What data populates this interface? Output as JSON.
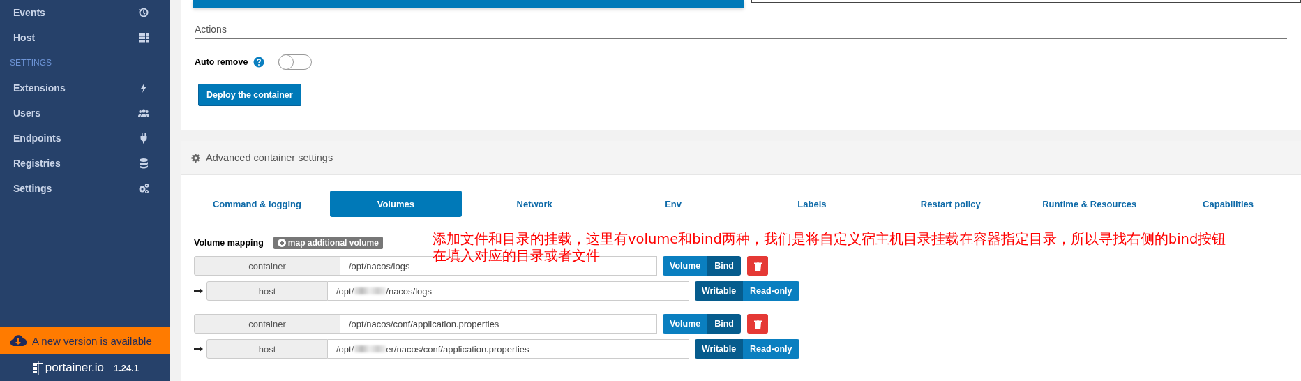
{
  "sidebar": {
    "items": [
      {
        "kind": "item",
        "label": "Events"
      },
      {
        "kind": "item",
        "label": "Host"
      },
      {
        "kind": "heading",
        "label": "SETTINGS"
      },
      {
        "kind": "item",
        "label": "Extensions"
      },
      {
        "kind": "item",
        "label": "Users"
      },
      {
        "kind": "item",
        "label": "Endpoints"
      },
      {
        "kind": "item",
        "label": "Registries"
      },
      {
        "kind": "item",
        "label": "Settings"
      }
    ],
    "update_banner": "A new version is available",
    "logo_text": "portainer.io",
    "version": "1.24.1"
  },
  "actions": {
    "heading": "Actions",
    "auto_remove": {
      "label": "Auto remove",
      "on": false
    },
    "deploy_button": "Deploy the container"
  },
  "advanced": {
    "title": "Advanced container settings",
    "tabs": [
      {
        "label": "Command & logging",
        "selected": false
      },
      {
        "label": "Volumes",
        "selected": true
      },
      {
        "label": "Network",
        "selected": false
      },
      {
        "label": "Env",
        "selected": false
      },
      {
        "label": "Labels",
        "selected": false
      },
      {
        "label": "Restart policy",
        "selected": false
      },
      {
        "label": "Runtime & Resources",
        "selected": false
      },
      {
        "label": "Capabilities",
        "selected": false
      }
    ],
    "volume_mapping_label": "Volume mapping",
    "add_button": "map additional volume",
    "mappings": [
      {
        "container_label": "container",
        "container_path": "/opt/nacos/logs",
        "types": [
          {
            "label": "Volume",
            "selected": false
          },
          {
            "label": "Bind",
            "selected": true
          }
        ],
        "host_label": "host",
        "host_path_start": "/opt/",
        "host_path_end": "/nacos/logs",
        "access": [
          {
            "label": "Writable",
            "selected": true
          },
          {
            "label": "Read-only",
            "selected": false
          }
        ]
      },
      {
        "container_label": "container",
        "container_path": "/opt/nacos/conf/application.properties",
        "types": [
          {
            "label": "Volume",
            "selected": false
          },
          {
            "label": "Bind",
            "selected": true
          }
        ],
        "host_label": "host",
        "host_path_start": "/opt/",
        "host_path_end": "er/nacos/conf/application.properties",
        "access": [
          {
            "label": "Writable",
            "selected": true
          },
          {
            "label": "Read-only",
            "selected": false
          }
        ]
      }
    ]
  },
  "annotation": [
    "添加文件和目录的挂载，这里有volume和bind两种，我们是将自定义宿主机目录挂载在容器指定目录，所以寻找右侧的bind按钮",
    "在填入对应的目录或者文件"
  ]
}
